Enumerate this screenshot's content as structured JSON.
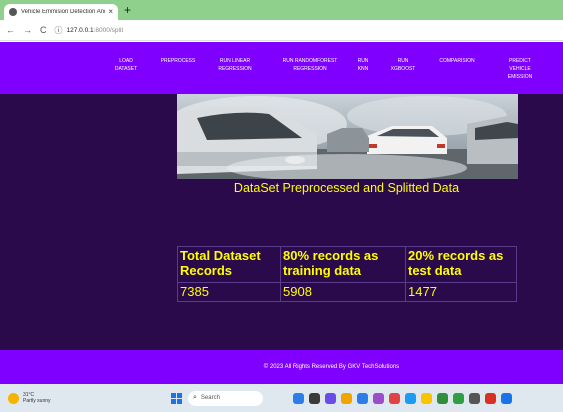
{
  "browser": {
    "tab_title": "Vehicle Emmision Detection And",
    "tab_close": "×",
    "new_tab": "+",
    "back": "←",
    "forward": "→",
    "reload": "C",
    "url_host": "127.0.0.1",
    "url_path": ":8000/split"
  },
  "nav": [
    {
      "label": "LOAD\nDATASET"
    },
    {
      "label": "PREPROCESS"
    },
    {
      "label": "RUN LINEAR\nREGRESSION"
    },
    {
      "label": "RUN RANDOMFOREST\nREGRESSION"
    },
    {
      "label": "RUN\nKNN"
    },
    {
      "label": "RUN\nXGBOOST"
    },
    {
      "label": "COMPARISION"
    },
    {
      "label": "PREDICT\nVEHICLE\nEMISSION"
    }
  ],
  "main": {
    "headline": "DataSet Preprocessed and Splitted Data",
    "table": {
      "headers": [
        "Total Dataset Records",
        "80% records as training data",
        "20% records as test data"
      ],
      "values": [
        "7385",
        "5908",
        "1477"
      ]
    }
  },
  "footer": {
    "text": "© 2023 All Rights Reserved By GKV TechSolutions"
  },
  "taskbar": {
    "temp": "31°C",
    "weather": "Partly sunny",
    "search_placeholder": "Search"
  },
  "colors": {
    "nav_bg": "#8000ff",
    "content_bg": "#2a0a4a",
    "accent_text": "#ffff00"
  }
}
